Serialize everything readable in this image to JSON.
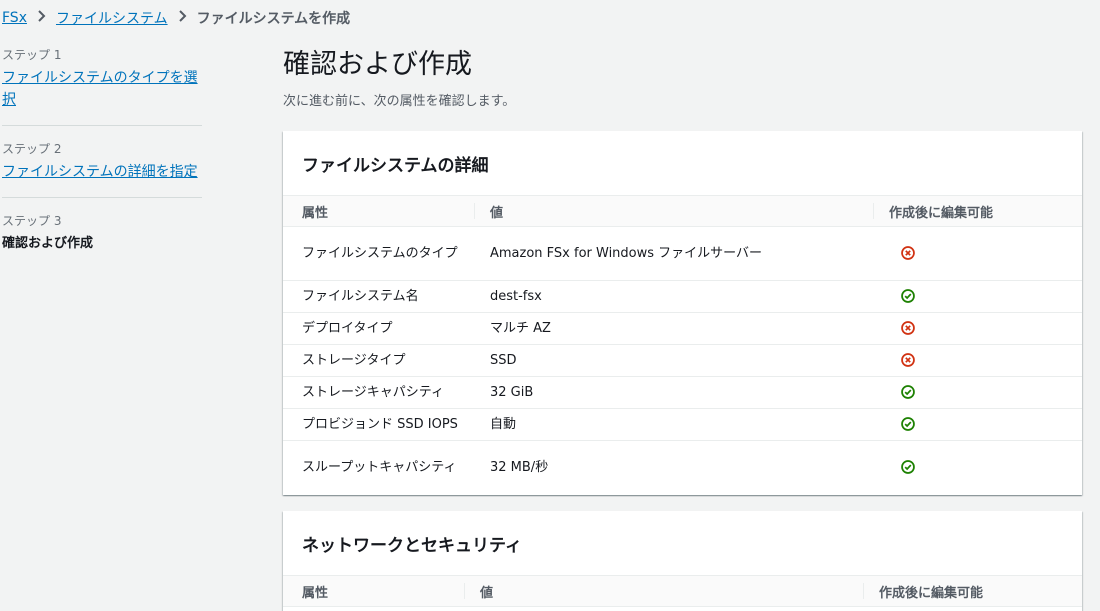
{
  "breadcrumb": {
    "items": [
      "FSx",
      "ファイルシステム"
    ],
    "current": "ファイルシステムを作成"
  },
  "steps": [
    {
      "num": "ステップ 1",
      "label": "ファイルシステムのタイプを選択"
    },
    {
      "num": "ステップ 2",
      "label": "ファイルシステムの詳細を指定"
    },
    {
      "num": "ステップ 3",
      "label": "確認および作成"
    }
  ],
  "page": {
    "title": "確認および作成",
    "subtitle": "次に進む前に、次の属性を確認します。"
  },
  "panels": [
    {
      "title": "ファイルシステムの詳細",
      "columns": [
        "属性",
        "値",
        "作成後に編集可能"
      ],
      "rows": [
        {
          "attr": "ファイルシステムのタイプ",
          "value": "Amazon FSx for Windows ファイルサーバー",
          "editable": false
        },
        {
          "attr": "ファイルシステム名",
          "value": "dest-fsx",
          "editable": true
        },
        {
          "attr": "デプロイタイプ",
          "value": "マルチ AZ",
          "editable": false
        },
        {
          "attr": "ストレージタイプ",
          "value": "SSD",
          "editable": false
        },
        {
          "attr": "ストレージキャパシティ",
          "value": "32 GiB",
          "editable": true
        },
        {
          "attr": "プロビジョンド SSD IOPS",
          "value": "自動",
          "editable": true
        },
        {
          "attr": "スループットキャパシティ",
          "value": "32 MB/秒",
          "editable": true
        }
      ]
    },
    {
      "title": "ネットワークとセキュリティ",
      "columns": [
        "属性",
        "値",
        "作成後に編集可能"
      ]
    }
  ],
  "colors": {
    "success": "#1d8102",
    "error": "#d13212",
    "link": "#0073bb"
  }
}
